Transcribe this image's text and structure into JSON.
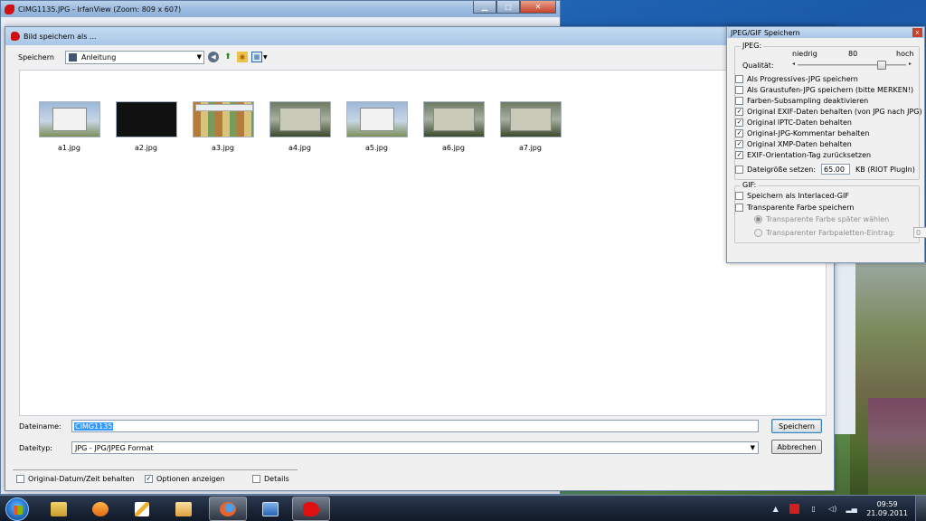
{
  "irfanview": {
    "title": "CIMG1135.JPG - IrfanView (Zoom: 809 x 607)",
    "controls": {
      "minimize": "▁",
      "maximize": "□",
      "close": "✕"
    }
  },
  "save_dialog": {
    "title": "Bild speichern als ...",
    "save_in_label": "Speichern",
    "folder": "Anleitung",
    "files": [
      {
        "name": "a1.jpg",
        "thumb": "desktop-screenshot"
      },
      {
        "name": "a2.jpg",
        "thumb": "black-screen"
      },
      {
        "name": "a3.jpg",
        "thumb": "image-grid"
      },
      {
        "name": "a4.jpg",
        "thumb": "photo-window"
      },
      {
        "name": "a5.jpg",
        "thumb": "desktop-screenshot"
      },
      {
        "name": "a6.jpg",
        "thumb": "photo-window"
      },
      {
        "name": "a7.jpg",
        "thumb": "photo-window"
      }
    ],
    "filename_label": "Dateiname:",
    "filename_value": "CIMG1135",
    "filetype_label": "Dateityp:",
    "filetype_value": "JPG - JPG/JPEG Format",
    "save_button": "Speichern",
    "cancel_button": "Abbrechen",
    "keep_date_label": "Original-Datum/Zeit behalten",
    "keep_date_checked": false,
    "show_options_label": "Optionen anzeigen",
    "show_options_checked": true,
    "details_label": "Details",
    "details_checked": false
  },
  "jpeg_gif": {
    "title": "JPEG/GIF Speichern",
    "close": "x",
    "jpeg_group": "JPEG:",
    "quality_label": "Qualität:",
    "low_label": "niedrig",
    "high_label": "hoch",
    "quality": 80,
    "jpeg_options": [
      {
        "label": "Als Progressives-JPG speichern",
        "checked": false
      },
      {
        "label": "Als Graustufen-JPG speichern (bitte MERKEN!)",
        "checked": false
      },
      {
        "label": "Farben-Subsampling deaktivieren",
        "checked": false
      },
      {
        "label": "Original EXIF-Daten behalten (von JPG nach JPG)",
        "checked": true
      },
      {
        "label": "Original IPTC-Daten behalten",
        "checked": true
      },
      {
        "label": "Original-JPG-Kommentar behalten",
        "checked": true
      },
      {
        "label": "Original XMP-Daten behalten",
        "checked": true
      },
      {
        "label": "EXIF-Orientation-Tag zurücksetzen",
        "checked": true
      }
    ],
    "filesize_label": "Dateigröße setzen:",
    "filesize_checked": false,
    "filesize_value": "65.00",
    "filesize_unit": "KB (RIOT PlugIn)",
    "gif_group": "GIF:",
    "gif_options": [
      {
        "label": "Speichern als Interlaced-GIF",
        "checked": false
      },
      {
        "label": "Transparente Farbe speichern",
        "checked": false
      }
    ],
    "radio_later": "Transparente Farbe später wählen",
    "radio_palette": "Transparenter Farbpaletten-Eintrag:",
    "palette_value": "0"
  },
  "taskbar": {
    "time": "09:59",
    "date": "21.09.2011"
  },
  "colors": {
    "selection": "#3399ff",
    "taskbar": "#1b2638",
    "irfan_red": "#d01010"
  }
}
